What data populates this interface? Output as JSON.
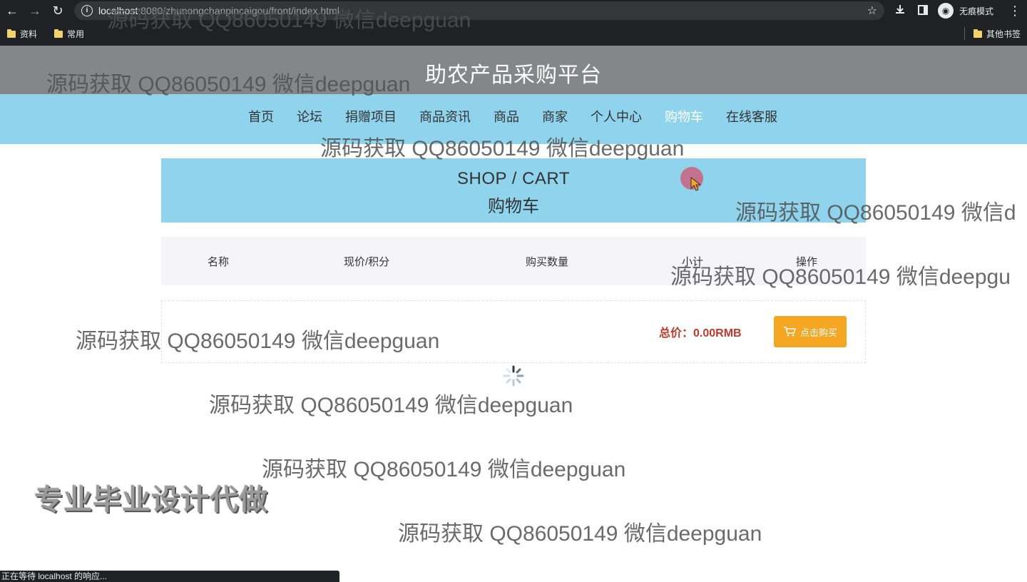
{
  "browser": {
    "url_host": "localhost",
    "url_rest": ":8080/zhunongchanpincaigou/front/index.html",
    "incognito_label": "无痕模式",
    "bookmarks": [
      "资料",
      "常用"
    ],
    "other_bookmarks": "其他书签",
    "status_text": "正在等待 localhost 的响应..."
  },
  "site": {
    "title": "助农产品采购平台",
    "nav": [
      "首页",
      "论坛",
      "捐赠项目",
      "商品资讯",
      "商品",
      "商家",
      "个人中心",
      "购物车",
      "在线客服"
    ],
    "active_nav": "购物车"
  },
  "cart": {
    "banner_en": "SHOP / CART",
    "banner_cn": "购物车",
    "columns": [
      "名称",
      "现价/积分",
      "购买数量",
      "小计",
      "操作"
    ],
    "total_label": "总价：",
    "total_value": "0.00RMB",
    "buy_label": "点击购买"
  },
  "overlays": {
    "watermark": "源码获取 QQ86050149 微信deepguan",
    "watermark_cut_1": "源码获取 QQ86050149 微信d",
    "watermark_cut_2": "源码获取 QQ86050149 微信deepgu",
    "promo": "专业毕业设计代做"
  },
  "colors": {
    "header_bg": "#848687",
    "nav_bg": "#8fd3ec",
    "buy_button": "#f5a623",
    "total_text": "#c0392b"
  }
}
